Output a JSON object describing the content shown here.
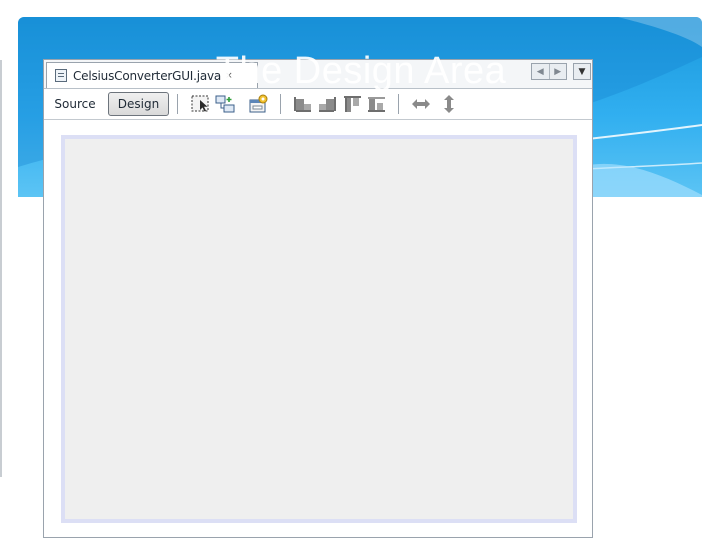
{
  "slide": {
    "title": "The Design Area"
  },
  "editor": {
    "tab_label": "CelsiusConverterGUI.java",
    "tab_close": "×",
    "nav_prev": "◀",
    "nav_next": "▶",
    "menu_glyph": "▼"
  },
  "toolbar": {
    "source_label": "Source",
    "design_label": "Design",
    "icons": [
      "selection-mode-icon",
      "connection-mode-icon",
      "preview-design-icon",
      "align-left-icon",
      "align-right-icon",
      "align-top-icon",
      "align-bottom-icon",
      "horizontal-resize-icon",
      "vertical-resize-icon"
    ]
  },
  "colors": {
    "header_blue": "#1a98dc",
    "design_area_fill": "#efefef",
    "design_area_border": "#dcdff5"
  }
}
